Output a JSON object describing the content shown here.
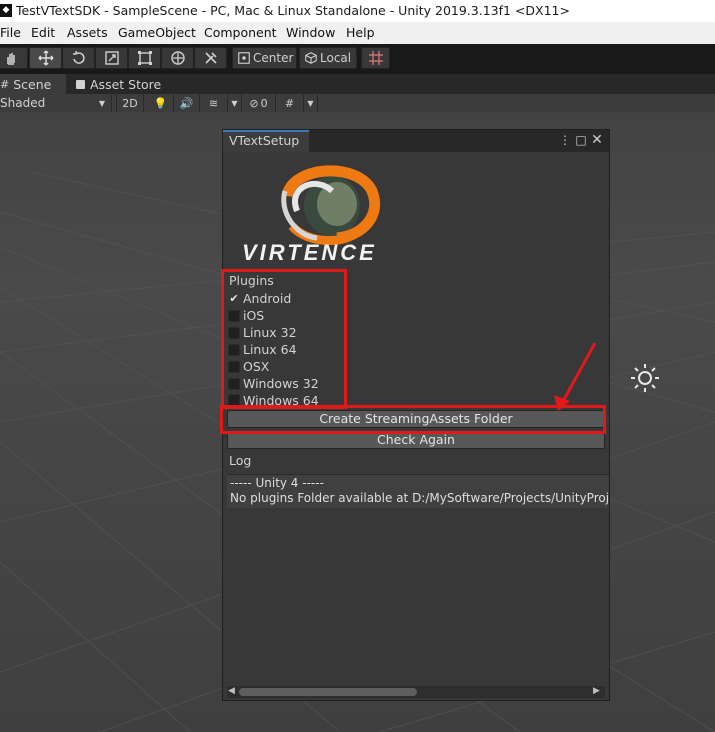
{
  "window": {
    "title": "TestVTextSDK - SampleScene - PC, Mac & Linux Standalone - Unity 2019.3.13f1 <DX11>"
  },
  "menu": [
    "File",
    "Edit",
    "Assets",
    "GameObject",
    "Component",
    "Window",
    "Help"
  ],
  "toolbar": {
    "tools": [
      "hand-tool",
      "move-tool",
      "rotate-tool",
      "scale-tool",
      "rect-tool",
      "transform-tool",
      "custom-tool"
    ],
    "pivot_label": "Center",
    "space_label": "Local"
  },
  "tabs": [
    {
      "label": "Scene",
      "icon": "scene-icon"
    },
    {
      "label": "Asset Store",
      "icon": "store-icon"
    }
  ],
  "scene_toolbar": {
    "draw_mode": "Shaded",
    "mode_2d": "2D",
    "hidden_count": "0"
  },
  "vtext_window": {
    "tab_label": "VTextSetup",
    "logo_text": "VIRTENCE",
    "plugins_label": "Plugins",
    "plugins": [
      {
        "label": "Android",
        "checked": true
      },
      {
        "label": "iOS",
        "checked": false
      },
      {
        "label": "Linux 32",
        "checked": false
      },
      {
        "label": "Linux 64",
        "checked": false
      },
      {
        "label": "OSX",
        "checked": false
      },
      {
        "label": "Windows 32",
        "checked": false
      },
      {
        "label": "Windows 64",
        "checked": false
      }
    ],
    "create_button": "Create StreamingAssets Folder",
    "check_button": "Check Again",
    "log_label": "Log",
    "log_lines": [
      "----- Unity 4 -----",
      "No plugins Folder available at D:/MySoftware/Projects/UnityProjects/TestVTextSDK/Assets/Plugins"
    ]
  },
  "colors": {
    "highlight": "#e11919",
    "accent_orange": "#f07a12",
    "tab_accent": "#3a79bb"
  }
}
